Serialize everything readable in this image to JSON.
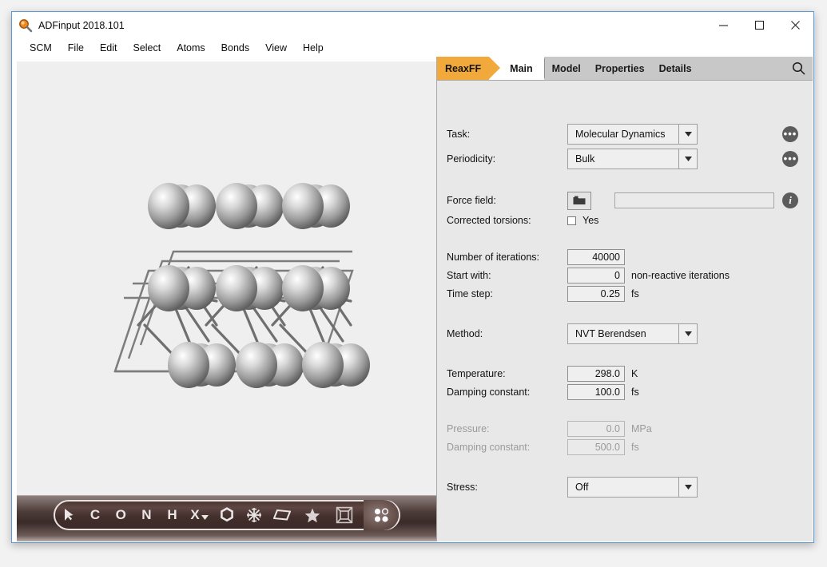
{
  "window": {
    "title": "ADFinput 2018.101",
    "icon": "magnifier-icon",
    "controls": {
      "minimize": "minimize-icon",
      "maximize": "maximize-icon",
      "close": "close-icon"
    }
  },
  "menu": {
    "items": [
      "SCM",
      "File",
      "Edit",
      "Select",
      "Atoms",
      "Bonds",
      "View",
      "Help"
    ]
  },
  "tabs": {
    "module": "ReaxFF",
    "active": "Main",
    "others": [
      "Model",
      "Properties",
      "Details"
    ],
    "search_icon": "search-icon"
  },
  "form": {
    "task": {
      "label": "Task:",
      "value": "Molecular Dynamics"
    },
    "periodicity": {
      "label": "Periodicity:",
      "value": "Bulk"
    },
    "force_field": {
      "label": "Force field:",
      "value": "",
      "browse_icon": "folder-icon"
    },
    "corrected_torsions": {
      "label": "Corrected torsions:",
      "checkbox_label": "Yes",
      "checked": false
    },
    "iterations": {
      "label": "Number of iterations:",
      "value": "40000"
    },
    "start_with": {
      "label": "Start with:",
      "value": "0",
      "unit": "non-reactive iterations"
    },
    "time_step": {
      "label": "Time step:",
      "value": "0.25",
      "unit": "fs"
    },
    "method": {
      "label": "Method:",
      "value": "NVT Berendsen"
    },
    "temperature": {
      "label": "Temperature:",
      "value": "298.0",
      "unit": "K"
    },
    "temp_damping": {
      "label": "Damping constant:",
      "value": "100.0",
      "unit": "fs"
    },
    "pressure": {
      "label": "Pressure:",
      "value": "0.0",
      "unit": "MPa",
      "disabled": true
    },
    "pressure_damping": {
      "label": "Damping constant:",
      "value": "500.0",
      "unit": "fs",
      "disabled": true
    },
    "stress": {
      "label": "Stress:",
      "value": "Off"
    }
  },
  "side_buttons": {
    "task_more": "more-options-icon",
    "periodicity_more": "more-options-icon",
    "force_field_info": "info-icon"
  },
  "mol_toolbar": {
    "items": [
      {
        "name": "select-arrow-icon",
        "label": ""
      },
      {
        "name": "element-c-button",
        "label": "C"
      },
      {
        "name": "element-o-button",
        "label": "O"
      },
      {
        "name": "element-n-button",
        "label": "N"
      },
      {
        "name": "element-h-button",
        "label": "H"
      },
      {
        "name": "element-other-button",
        "label": "X"
      },
      {
        "name": "ring-tool-icon",
        "label": ""
      },
      {
        "name": "crystal-tool-icon",
        "label": ""
      },
      {
        "name": "plane-tool-icon",
        "label": ""
      }
    ],
    "right_items": [
      {
        "name": "favorites-star-icon",
        "label": ""
      },
      {
        "name": "bounding-box-icon",
        "label": ""
      },
      {
        "name": "scene-dots-icon",
        "label": ""
      }
    ]
  },
  "colors": {
    "accent_orange": "#f2a93b",
    "window_border": "#5b9bd5",
    "panel_bg": "#e8e8e8",
    "tabstrip_bg": "#c8c8c8",
    "toolbar_dark": "#43302c"
  }
}
